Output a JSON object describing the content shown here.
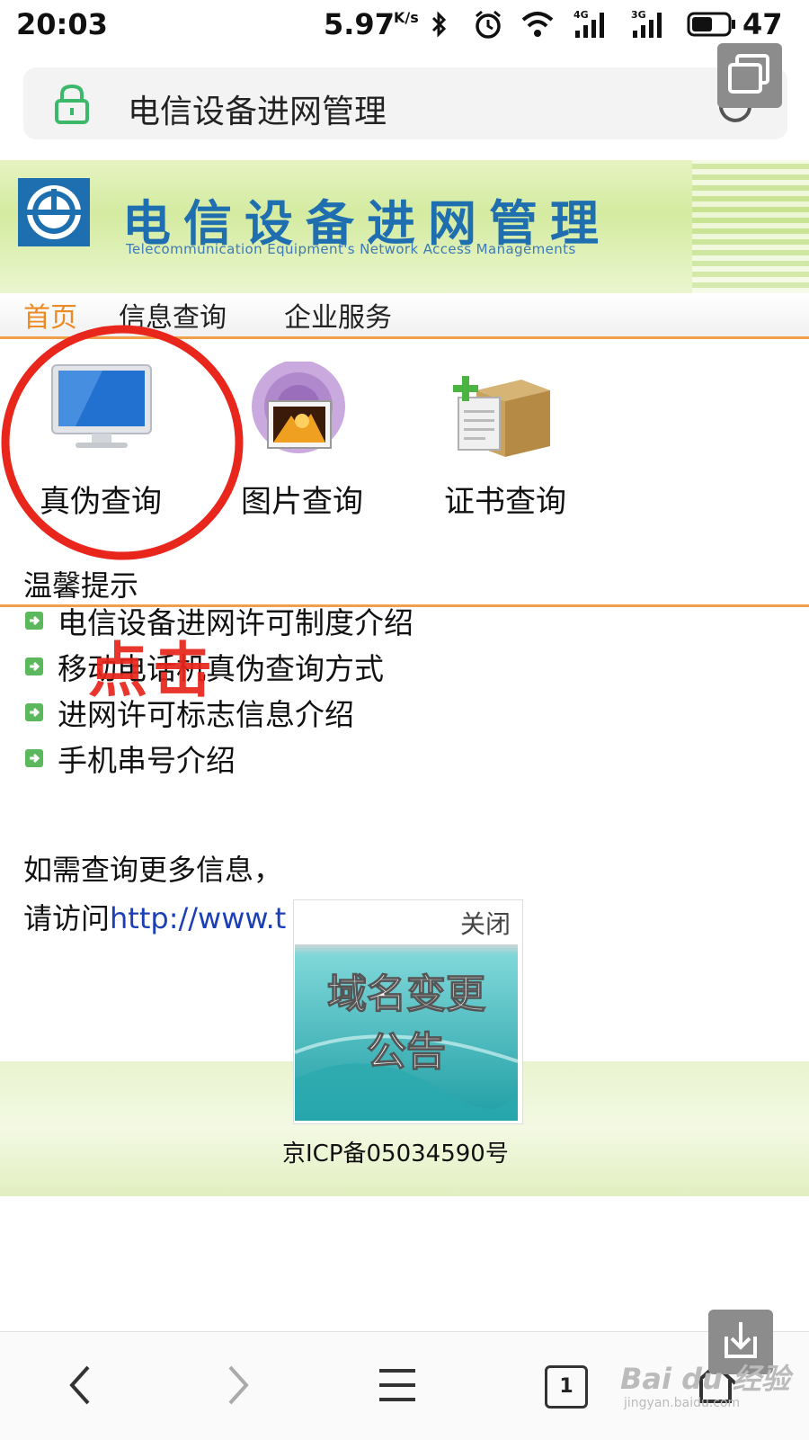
{
  "status_bar": {
    "time": "20:03",
    "net_speed": "5.97",
    "net_speed_unit": "K/s",
    "signal_labels": [
      "4G",
      "3G"
    ],
    "battery": "47",
    "icons": [
      "bluetooth-icon",
      "alarm-icon",
      "wifi-icon",
      "signal-icon",
      "battery-icon"
    ]
  },
  "address_bar": {
    "title": "电信设备进网管理",
    "icons": [
      "lock-icon",
      "refresh-icon"
    ]
  },
  "banner": {
    "title": "电信设备进网管理",
    "subtitle": "Telecommunication Equipment's Network Access Managements"
  },
  "nav": {
    "items": [
      "首页",
      "信息查询",
      "企业服务"
    ],
    "active": "首页",
    "active_color": "#ec8a23"
  },
  "tiles": [
    {
      "label": "真伪查询",
      "icon": "monitor-icon"
    },
    {
      "label": "图片查询",
      "icon": "picture-icon"
    },
    {
      "label": "证书查询",
      "icon": "certificate-box-icon"
    }
  ],
  "tips": {
    "title": "温馨提示",
    "items": [
      "电信设备进网许可制度介绍",
      "移动电话机真伪查询方式",
      "进网许可标志信息介绍",
      "手机串号介绍"
    ]
  },
  "annotation": {
    "text": "点击",
    "color": "#e8261c"
  },
  "more_info": {
    "line1": "如需查询更多信息，",
    "line2_prefix": "请访问",
    "line2_link": "http://www.t"
  },
  "popup": {
    "close_label": "关闭",
    "banner_line1": "域名变更",
    "banner_line2": "公告"
  },
  "footer": {
    "icp": "京ICP备05034590号"
  },
  "bottom_toolbar": {
    "tab_count": "1",
    "icons": [
      "back-icon",
      "forward-icon",
      "menu-icon",
      "tabs-icon",
      "home-icon"
    ]
  },
  "watermark": {
    "text": "Bai du 经验",
    "sub": "jingyan.baidu.com"
  }
}
